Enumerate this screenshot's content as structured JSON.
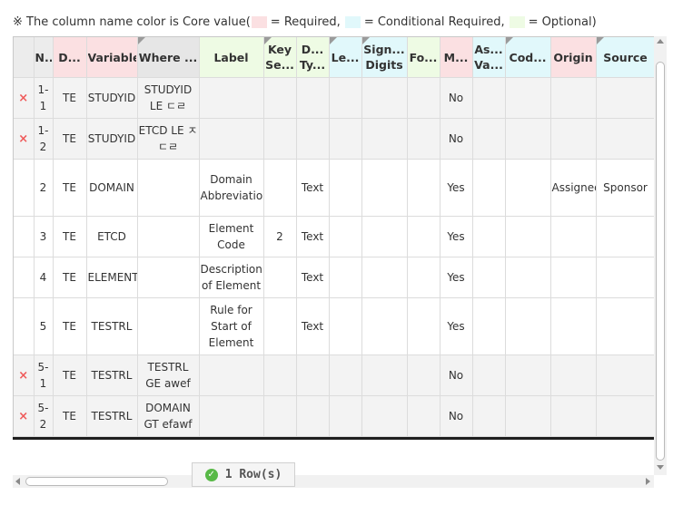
{
  "legend": {
    "prefix": "※ The column name color is Core value(",
    "required_label": " = Required,",
    "conditional_label": " = Conditional Required,",
    "optional_label": " = Optional)",
    "required_color": "#fbe0e2",
    "conditional_color": "#e1f8fb",
    "optional_color": "#eefbe4"
  },
  "columns": [
    {
      "key": "del",
      "label": "",
      "style": "plain",
      "marker": false
    },
    {
      "key": "no",
      "label": "N..",
      "style": "plain",
      "marker": false
    },
    {
      "key": "domain",
      "label": "D...",
      "style": "req",
      "marker": false
    },
    {
      "key": "variable",
      "label": "Variable",
      "style": "req",
      "marker": false
    },
    {
      "key": "where",
      "label": "Where ...",
      "style": "where",
      "marker": true
    },
    {
      "key": "label",
      "label": "Label",
      "style": "opt",
      "marker": false
    },
    {
      "key": "keyseq",
      "label": "Key Se...",
      "style": "opt",
      "marker": true
    },
    {
      "key": "datatype",
      "label": "D... Ty...",
      "style": "opt",
      "marker": false
    },
    {
      "key": "length",
      "label": "Le...",
      "style": "cond",
      "marker": true
    },
    {
      "key": "sigdigits",
      "label": "Sign... Digits",
      "style": "cond",
      "marker": true
    },
    {
      "key": "format",
      "label": "Fo...",
      "style": "opt",
      "marker": false
    },
    {
      "key": "mandatory",
      "label": "M...",
      "style": "req",
      "marker": false
    },
    {
      "key": "assigned",
      "label": "As... Va...",
      "style": "cond",
      "marker": false
    },
    {
      "key": "codelist",
      "label": "Cod...",
      "style": "cond",
      "marker": true
    },
    {
      "key": "origin",
      "label": "Origin",
      "style": "req",
      "marker": false
    },
    {
      "key": "source",
      "label": "Source",
      "style": "cond",
      "marker": true
    }
  ],
  "rows": [
    {
      "deletable": true,
      "shade": true,
      "height": 45,
      "cells": {
        "no": "1-1",
        "domain": "TE",
        "variable": "STUDYID",
        "where": "STUDYID LE ㄷㄹ",
        "label": "",
        "keyseq": "",
        "datatype": "",
        "length": "",
        "sigdigits": "",
        "format": "",
        "mandatory": "No",
        "assigned": "",
        "codelist": "",
        "origin": "",
        "source": ""
      }
    },
    {
      "deletable": true,
      "shade": true,
      "height": 45,
      "cells": {
        "no": "1-2",
        "domain": "TE",
        "variable": "STUDYID",
        "where": "ETCD LE ㅈㄷㄹ",
        "label": "",
        "keyseq": "",
        "datatype": "",
        "length": "",
        "sigdigits": "",
        "format": "",
        "mandatory": "No",
        "assigned": "",
        "codelist": "",
        "origin": "",
        "source": ""
      }
    },
    {
      "deletable": false,
      "shade": false,
      "height": 63,
      "cells": {
        "no": "2",
        "domain": "TE",
        "variable": "DOMAIN",
        "where": "",
        "label": "Domain Abbreviation",
        "keyseq": "",
        "datatype": "Text",
        "length": "",
        "sigdigits": "",
        "format": "",
        "mandatory": "Yes",
        "assigned": "",
        "codelist": "",
        "origin": "Assigned",
        "source": "Sponsor"
      }
    },
    {
      "deletable": false,
      "shade": false,
      "height": 45,
      "cells": {
        "no": "3",
        "domain": "TE",
        "variable": "ETCD",
        "where": "",
        "label": "Element Code",
        "keyseq": "2",
        "datatype": "Text",
        "length": "",
        "sigdigits": "",
        "format": "",
        "mandatory": "Yes",
        "assigned": "",
        "codelist": "",
        "origin": "",
        "source": ""
      }
    },
    {
      "deletable": false,
      "shade": false,
      "height": 45,
      "cells": {
        "no": "4",
        "domain": "TE",
        "variable": "ELEMENT",
        "where": "",
        "label": "Description of Element",
        "keyseq": "",
        "datatype": "Text",
        "length": "",
        "sigdigits": "",
        "format": "",
        "mandatory": "Yes",
        "assigned": "",
        "codelist": "",
        "origin": "",
        "source": ""
      }
    },
    {
      "deletable": false,
      "shade": false,
      "height": 63,
      "cells": {
        "no": "5",
        "domain": "TE",
        "variable": "TESTRL",
        "where": "",
        "label": "Rule for Start of Element",
        "keyseq": "",
        "datatype": "Text",
        "length": "",
        "sigdigits": "",
        "format": "",
        "mandatory": "Yes",
        "assigned": "",
        "codelist": "",
        "origin": "",
        "source": ""
      }
    },
    {
      "deletable": true,
      "shade": true,
      "height": 45,
      "cells": {
        "no": "5-1",
        "domain": "TE",
        "variable": "TESTRL",
        "where": "TESTRL GE awef",
        "label": "",
        "keyseq": "",
        "datatype": "",
        "length": "",
        "sigdigits": "",
        "format": "",
        "mandatory": "No",
        "assigned": "",
        "codelist": "",
        "origin": "",
        "source": ""
      }
    },
    {
      "deletable": true,
      "shade": true,
      "height": 45,
      "cells": {
        "no": "5-2",
        "domain": "TE",
        "variable": "TESTRL",
        "where": "DOMAIN GT efawf",
        "label": "",
        "keyseq": "",
        "datatype": "",
        "length": "",
        "sigdigits": "",
        "format": "",
        "mandatory": "No",
        "assigned": "",
        "codelist": "",
        "origin": "",
        "source": ""
      }
    }
  ],
  "delete_glyph": "×",
  "footer": {
    "row_count": "1 Row(s)",
    "check_glyph": "✓"
  }
}
